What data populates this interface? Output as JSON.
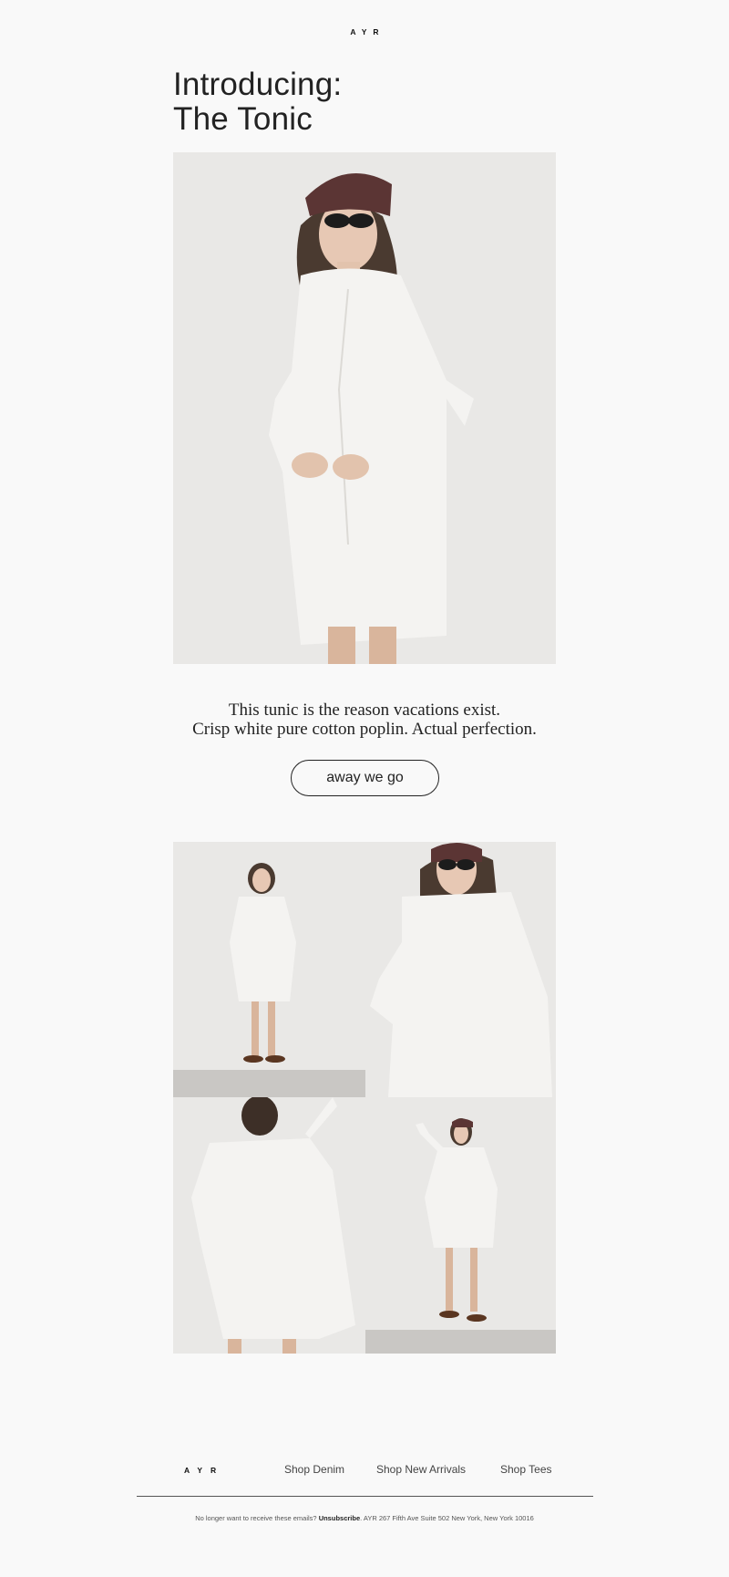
{
  "brand": {
    "logo": "AYR"
  },
  "headline": {
    "line1": "Introducing:",
    "line2": "The Tonic"
  },
  "body": {
    "line1": "This tunic is the reason vacations exist.",
    "line2": "Crisp white pure cotton poplin. Actual perfection."
  },
  "cta": {
    "label": "away we go"
  },
  "footer": {
    "logo": "AYR",
    "links": [
      "Shop Denim",
      "Shop New Arrivals",
      "Shop Tees"
    ],
    "legal_prefix": "No longer want to receive these emails?",
    "unsubscribe": "Unsubscribe",
    "address": ". AYR 267 Fifth Ave Suite 502 New York, New York 10016"
  },
  "colors": {
    "background": "#f9f9f9",
    "text": "#222222",
    "scarf": "#5b3534",
    "dress": "#f4f3f1"
  }
}
